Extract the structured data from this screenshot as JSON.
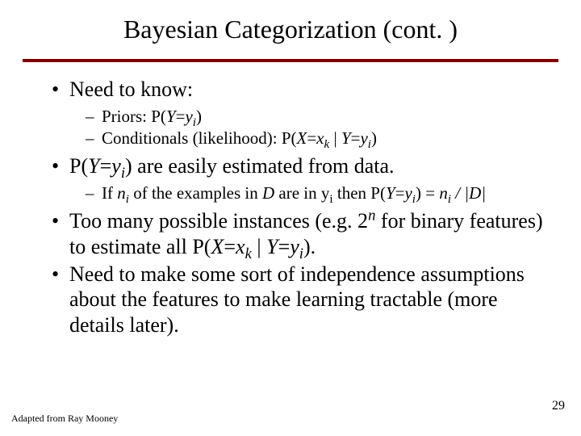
{
  "title": "Bayesian Categorization (cont. )",
  "content": {
    "b1": {
      "text": "Need to know:",
      "sub": {
        "s1_pre": "Priors: P(",
        "s1_Y": "Y",
        "s1_eq": "=",
        "s1_y": "y",
        "s1_i": "i",
        "s1_post": ")",
        "s2_pre": "Conditionals (likelihood): P(",
        "s2_X": "X",
        "s2_eq1": "=",
        "s2_x": "x",
        "s2_k": "k",
        "s2_bar": " | ",
        "s2_Y": "Y",
        "s2_eq2": "=",
        "s2_y": "y",
        "s2_i": "i",
        "s2_post": ")"
      }
    },
    "b2": {
      "pre": "P(",
      "Y": "Y",
      "eq": "=",
      "y": "y",
      "i": "i",
      "post": ") are easily estimated from data.",
      "sub": {
        "pre": "If ",
        "n": "n",
        "i1": "i",
        "mid1": " of the examples in ",
        "D": "D",
        "mid2": " are in y",
        "i2": "i",
        "mid3": " then P(",
        "Y": "Y",
        "eq": "=",
        "y": "y",
        "i3": "i",
        "mid4": ") =  ",
        "n2": "n",
        "i4": "i",
        "mid5": " / |",
        "D2": "D",
        "post": "|"
      }
    },
    "b3": {
      "pre": "Too many possible instances (e.g. 2",
      "sup": "n",
      "mid": " for binary features) to estimate all P(",
      "X": "X",
      "eq1": "=",
      "x": "x",
      "k": "k",
      "bar": " | ",
      "Y": "Y",
      "eq2": "=",
      "y": "y",
      "i": "i",
      "post": ")."
    },
    "b4": "Need to make some sort of independence assumptions about the features to make learning tractable (more details later).",
    "footer_left": "Adapted from Ray Mooney",
    "footer_right": "29"
  }
}
